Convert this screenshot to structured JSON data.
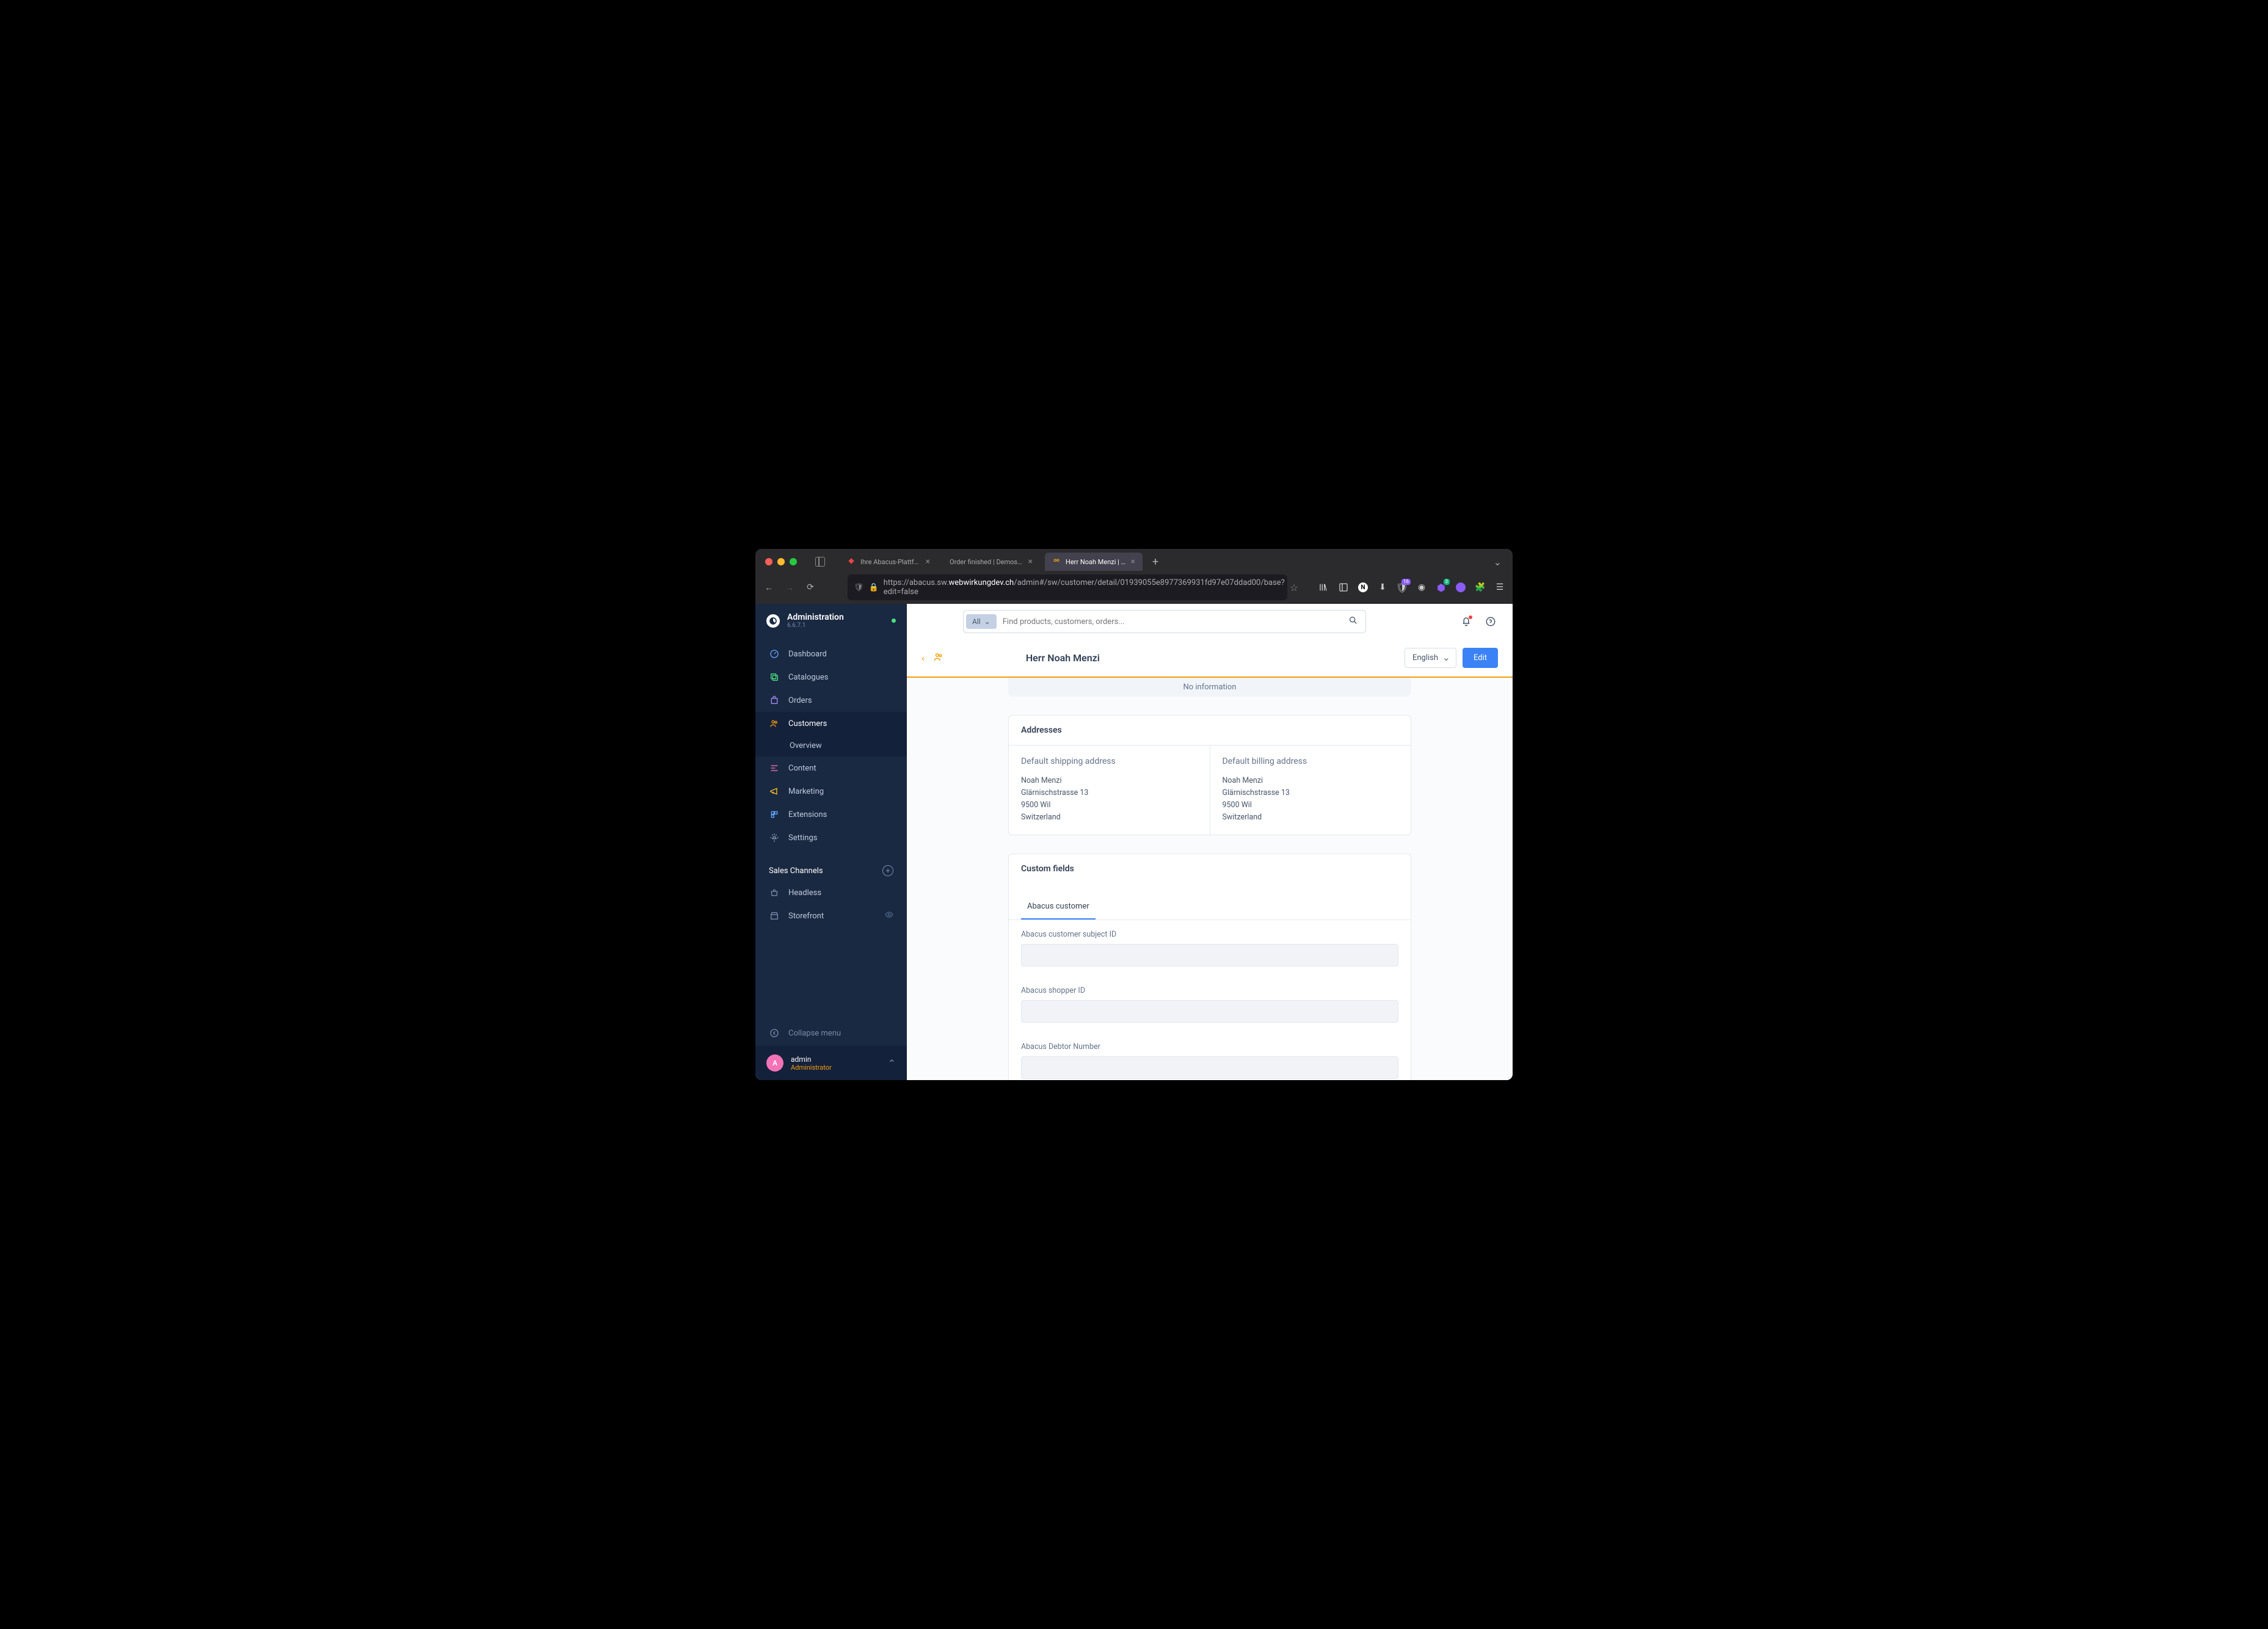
{
  "browser": {
    "tabs": [
      {
        "title": "Ihre Abacus-Plattform",
        "active": false
      },
      {
        "title": "Order finished | Demostore",
        "active": false
      },
      {
        "title": "Herr Noah Menzi | Customers |",
        "active": true
      }
    ],
    "url_prefix": "https://abacus.sw.",
    "url_host": "webwirkungdev.ch",
    "url_path": "/admin#/sw/customer/detail/01939055e8977369931fd97e07ddad00/base?edit=false",
    "toolbar_badge_1": "16",
    "toolbar_badge_2": "3"
  },
  "sidebar": {
    "title": "Administration",
    "version": "6.6.7.1",
    "nav": [
      {
        "label": "Dashboard",
        "icon": "gauge",
        "color": "#60a5fa"
      },
      {
        "label": "Catalogues",
        "icon": "stack",
        "color": "#4ade80"
      },
      {
        "label": "Orders",
        "icon": "bag",
        "color": "#a78bfa"
      },
      {
        "label": "Customers",
        "icon": "users",
        "color": "#f59e0b",
        "active": true
      },
      {
        "label": "Overview",
        "sub": true
      },
      {
        "label": "Content",
        "icon": "layout",
        "color": "#f472b6"
      },
      {
        "label": "Marketing",
        "icon": "megaphone",
        "color": "#fbbf24"
      },
      {
        "label": "Extensions",
        "icon": "puzzle",
        "color": "#60a5fa"
      },
      {
        "label": "Settings",
        "icon": "gear",
        "color": "#94a3b8"
      }
    ],
    "section_title": "Sales Channels",
    "channels": [
      {
        "label": "Headless",
        "icon": "basket"
      },
      {
        "label": "Storefront",
        "icon": "store",
        "eye": true
      }
    ],
    "collapse": "Collapse menu",
    "user": {
      "initial": "A",
      "name": "admin",
      "role": "Administrator"
    }
  },
  "header": {
    "search_pill": "All",
    "search_placeholder": "Find products, customers, orders..."
  },
  "page": {
    "title": "Herr Noah Menzi",
    "language": "English",
    "edit": "Edit",
    "no_info": "No information"
  },
  "addresses": {
    "heading": "Addresses",
    "shipping": {
      "title": "Default shipping address",
      "name": "Noah Menzi",
      "street": "Glärnischstrasse 13",
      "city": "9500 Wil",
      "country": "Switzerland"
    },
    "billing": {
      "title": "Default billing address",
      "name": "Noah Menzi",
      "street": "Glärnischstrasse 13",
      "city": "9500 Wil",
      "country": "Switzerland"
    }
  },
  "custom_fields": {
    "heading": "Custom fields",
    "tab": "Abacus customer",
    "fields": [
      {
        "label": "Abacus customer subject ID",
        "value": ""
      },
      {
        "label": "Abacus shopper ID",
        "value": ""
      },
      {
        "label": "Abacus Debtor Number",
        "value": ""
      }
    ]
  }
}
